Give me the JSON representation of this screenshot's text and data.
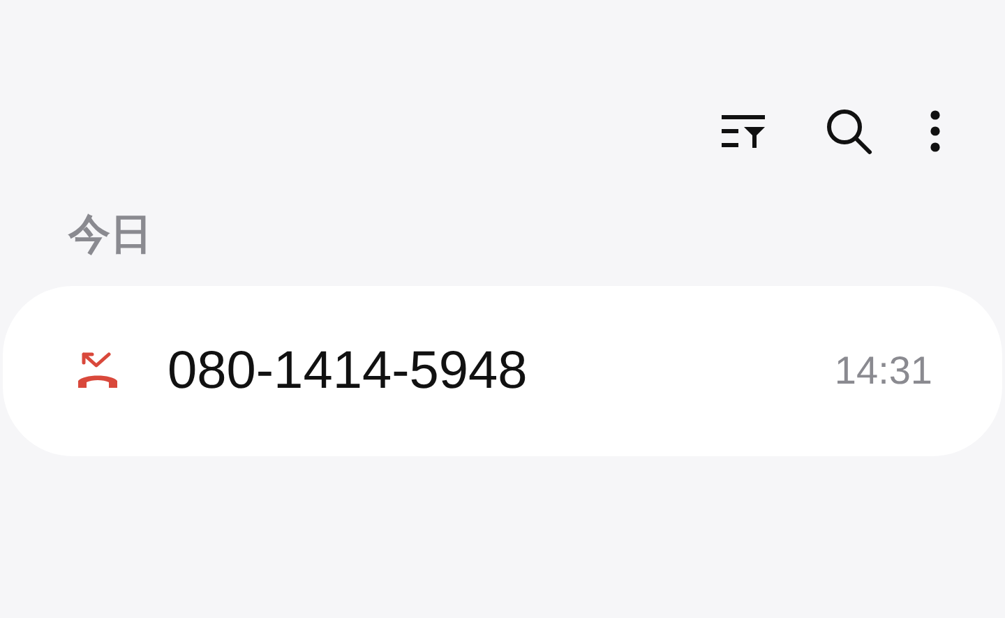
{
  "section": {
    "title": "今日"
  },
  "calls": [
    {
      "kind": "missed",
      "number": "080-1414-5948",
      "time": "14:31"
    }
  ]
}
